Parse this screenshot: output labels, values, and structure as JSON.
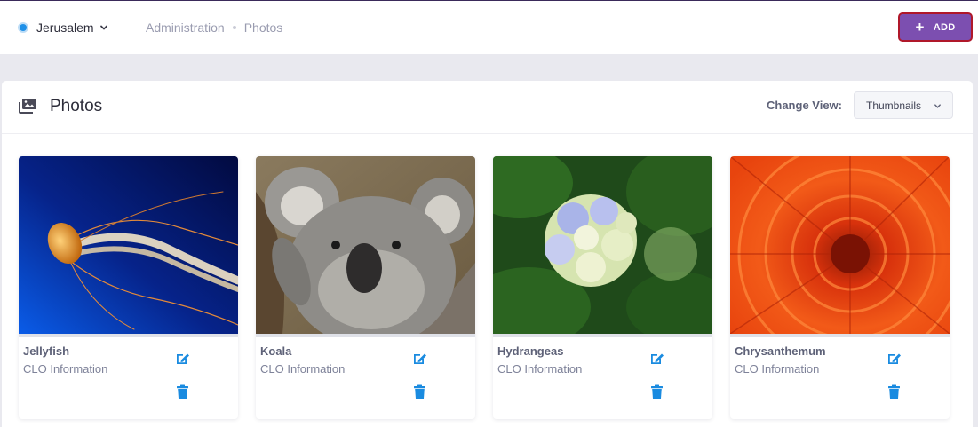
{
  "header": {
    "location": "Jerusalem",
    "breadcrumb": [
      "Administration",
      "Photos"
    ],
    "add_label": "ADD"
  },
  "page": {
    "title": "Photos",
    "change_view_label": "Change View:",
    "view_selected": "Thumbnails"
  },
  "photos": [
    {
      "name": "Jellyfish",
      "subtitle": "CLO Information",
      "image": "jellyfish-photo"
    },
    {
      "name": "Koala",
      "subtitle": "CLO Information",
      "image": "koala-photo"
    },
    {
      "name": "Hydrangeas",
      "subtitle": "CLO Information",
      "image": "hydrangeas-photo"
    },
    {
      "name": "Chrysanthemum",
      "subtitle": "CLO Information",
      "image": "chrysanthemum-photo"
    }
  ],
  "colors": {
    "accent": "#7c4fb0",
    "icon_blue": "#1a8be0",
    "location_dot": "#1e90e8"
  },
  "icons": [
    "chevron-down-icon",
    "plus-icon",
    "images-icon",
    "edit-icon",
    "trash-icon"
  ]
}
